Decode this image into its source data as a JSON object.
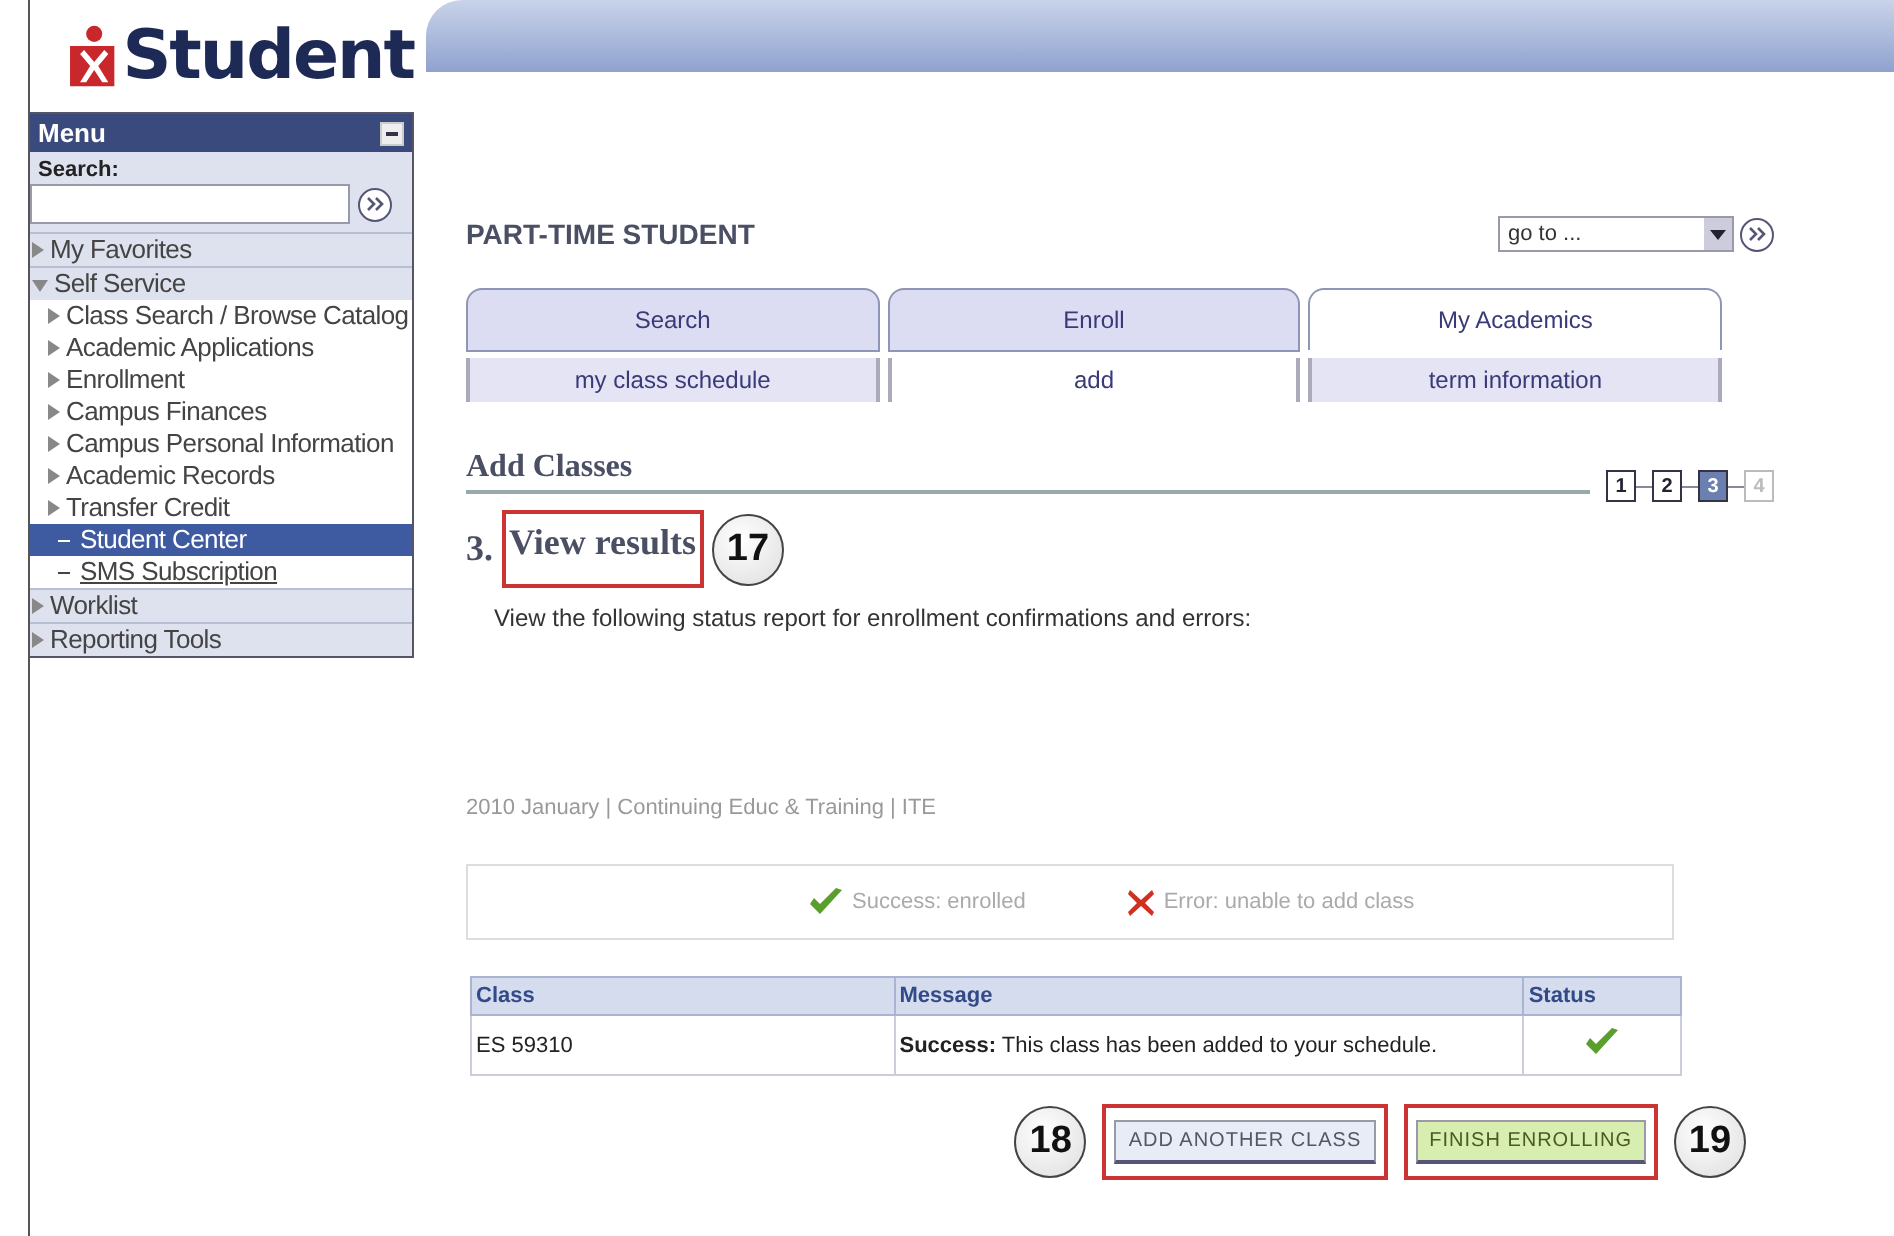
{
  "logo": {
    "text": "Student"
  },
  "menu": {
    "title": "Menu",
    "search_label": "Search:",
    "items": [
      {
        "label": "My Favorites",
        "kind": "folder",
        "expanded": false,
        "selected": false
      },
      {
        "label": "Self Service",
        "kind": "folder",
        "expanded": true,
        "selected": false,
        "children": [
          {
            "label": "Class Search / Browse Catalog",
            "kind": "folder",
            "expanded": false,
            "selected": false
          },
          {
            "label": "Academic Applications",
            "kind": "folder",
            "expanded": false,
            "selected": false
          },
          {
            "label": "Enrollment",
            "kind": "folder",
            "expanded": false,
            "selected": false
          },
          {
            "label": "Campus Finances",
            "kind": "folder",
            "expanded": false,
            "selected": false
          },
          {
            "label": "Campus Personal Information",
            "kind": "folder",
            "expanded": false,
            "selected": false
          },
          {
            "label": "Academic Records",
            "kind": "folder",
            "expanded": false,
            "selected": false
          },
          {
            "label": "Transfer Credit",
            "kind": "folder",
            "expanded": false,
            "selected": false
          },
          {
            "label": "Student Center",
            "kind": "link",
            "selected": true
          },
          {
            "label": "SMS Subscription",
            "kind": "link",
            "selected": false
          }
        ]
      },
      {
        "label": "Worklist",
        "kind": "folder",
        "expanded": false,
        "selected": false
      },
      {
        "label": "Reporting Tools",
        "kind": "folder",
        "expanded": false,
        "selected": false
      }
    ]
  },
  "page_title": "PART-TIME STUDENT",
  "goto": {
    "value": "go to ..."
  },
  "tabs": [
    {
      "label": "Search",
      "selected": false
    },
    {
      "label": "Enroll",
      "selected": false
    },
    {
      "label": "My Academics",
      "selected": true
    }
  ],
  "subtabs": [
    {
      "label": "my class schedule",
      "selected": false
    },
    {
      "label": "add",
      "selected": true
    },
    {
      "label": "term information",
      "selected": false
    }
  ],
  "section_title": "Add Classes",
  "steps": [
    {
      "label": "1",
      "selected": false,
      "disabled": false
    },
    {
      "label": "2",
      "selected": false,
      "disabled": false
    },
    {
      "label": "3",
      "selected": true,
      "disabled": false
    },
    {
      "label": "4",
      "selected": false,
      "disabled": true
    }
  ],
  "step_heading": {
    "number": "3.",
    "title": "View results",
    "callout": "17"
  },
  "instructions": "View the following status report for enrollment confirmations and errors:",
  "term": "2010 January | Continuing Educ & Training | ITE",
  "legend": [
    {
      "kind": "success",
      "label": "Success: enrolled"
    },
    {
      "kind": "error",
      "label": "Error: unable to add class"
    }
  ],
  "table": {
    "columns": [
      "Class",
      "Message",
      "Status"
    ],
    "rows": [
      {
        "class": "ES 59310",
        "message": "**Success:** This class has been added to your schedule.",
        "kind": "success"
      }
    ]
  },
  "buttons": [
    {
      "label": "ADD ANOTHER CLASS",
      "kind": "secondary",
      "callout": "18"
    },
    {
      "label": "FINISH ENROLLING",
      "kind": "primary",
      "callout": "19"
    }
  ]
}
